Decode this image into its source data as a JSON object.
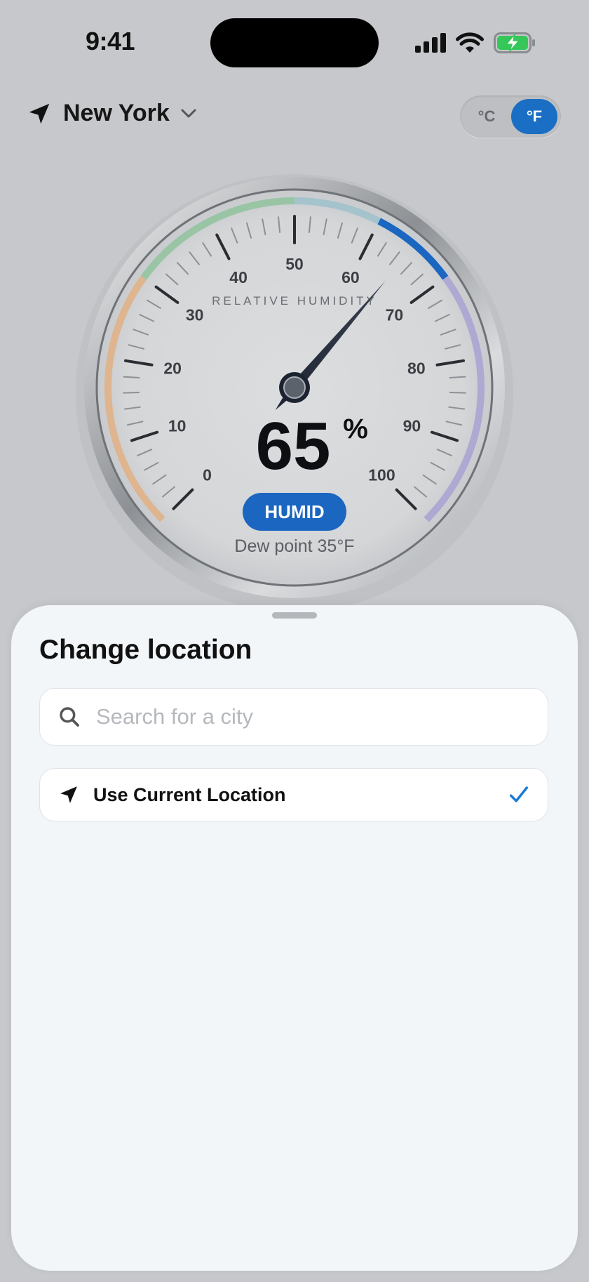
{
  "status_bar": {
    "time": "9:41"
  },
  "header": {
    "location_name": "New York"
  },
  "units": {
    "celsius_label": "°C",
    "fahrenheit_label": "°F",
    "selected": "°F"
  },
  "gauge": {
    "title": "RELATIVE HUMIDITY",
    "value": 65,
    "value_text": "65",
    "unit": "%",
    "status_label": "HUMID",
    "dew_point": "Dew point 35°F",
    "min": 0,
    "max": 100,
    "tick_labels": [
      "0",
      "10",
      "20",
      "30",
      "40",
      "50",
      "60",
      "70",
      "80",
      "90",
      "100"
    ],
    "zones": [
      {
        "from": 0,
        "to": 30,
        "color": "#e0b084"
      },
      {
        "from": 30,
        "to": 50,
        "color": "#8fc39e"
      },
      {
        "from": 50,
        "to": 60,
        "color": "#9ec1cc"
      },
      {
        "from": 60,
        "to": 70,
        "color": "#1a66c0"
      },
      {
        "from": 70,
        "to": 100,
        "color": "#a7a2d2"
      }
    ],
    "accent_color": "#1a66c0"
  },
  "sheet": {
    "title": "Change location",
    "search_placeholder": "Search for a city",
    "current_location_label": "Use Current Location",
    "current_location_selected": true,
    "check_color": "#1a7ad6"
  }
}
